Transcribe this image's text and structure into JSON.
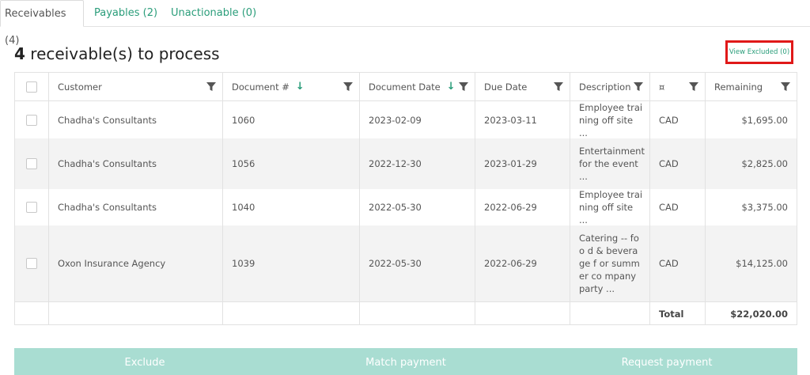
{
  "tabs": [
    {
      "label": "Receivables (4)"
    },
    {
      "label": "Payables (2)"
    },
    {
      "label": "Unactionable (0)"
    }
  ],
  "heading": {
    "count": "4",
    "text": "receivable(s) to process"
  },
  "view_excluded": "View Excluded (0)",
  "columns": {
    "customer": "Customer",
    "document": "Document #",
    "document_date": "Document Date",
    "due_date": "Due Date",
    "description": "Description",
    "currency": "¤",
    "remaining": "Remaining"
  },
  "rows": [
    {
      "customer": "Chadha's Consultants",
      "document": "1060",
      "document_date": "2023-02-09",
      "due_date": "2023-03-11",
      "description": "Employee trai ning off site ...",
      "currency": "CAD",
      "remaining": "$1,695.00"
    },
    {
      "customer": "Chadha's Consultants",
      "document": "1056",
      "document_date": "2022-12-30",
      "due_date": "2023-01-29",
      "description": "Entertainment for the event ...",
      "currency": "CAD",
      "remaining": "$2,825.00"
    },
    {
      "customer": "Chadha's Consultants",
      "document": "1040",
      "document_date": "2022-05-30",
      "due_date": "2022-06-29",
      "description": "Employee trai ning off site ...",
      "currency": "CAD",
      "remaining": "$3,375.00"
    },
    {
      "customer": "Oxon Insurance Agency",
      "document": "1039",
      "document_date": "2022-05-30",
      "due_date": "2022-06-29",
      "description": "Catering -- foo d & beverage f or summer co mpany party ...",
      "currency": "CAD",
      "remaining": "$14,125.00"
    }
  ],
  "total": {
    "label": "Total",
    "value": "$22,020.00"
  },
  "actions": {
    "exclude": "Exclude",
    "match": "Match payment",
    "request": "Request payment"
  },
  "colors": {
    "accent": "#2a9d7a",
    "highlight": "#e01919",
    "action_bar": "#a9ddd2"
  },
  "icons": {
    "filter": "filter-icon",
    "sort": "sort-down-arrow-icon"
  }
}
